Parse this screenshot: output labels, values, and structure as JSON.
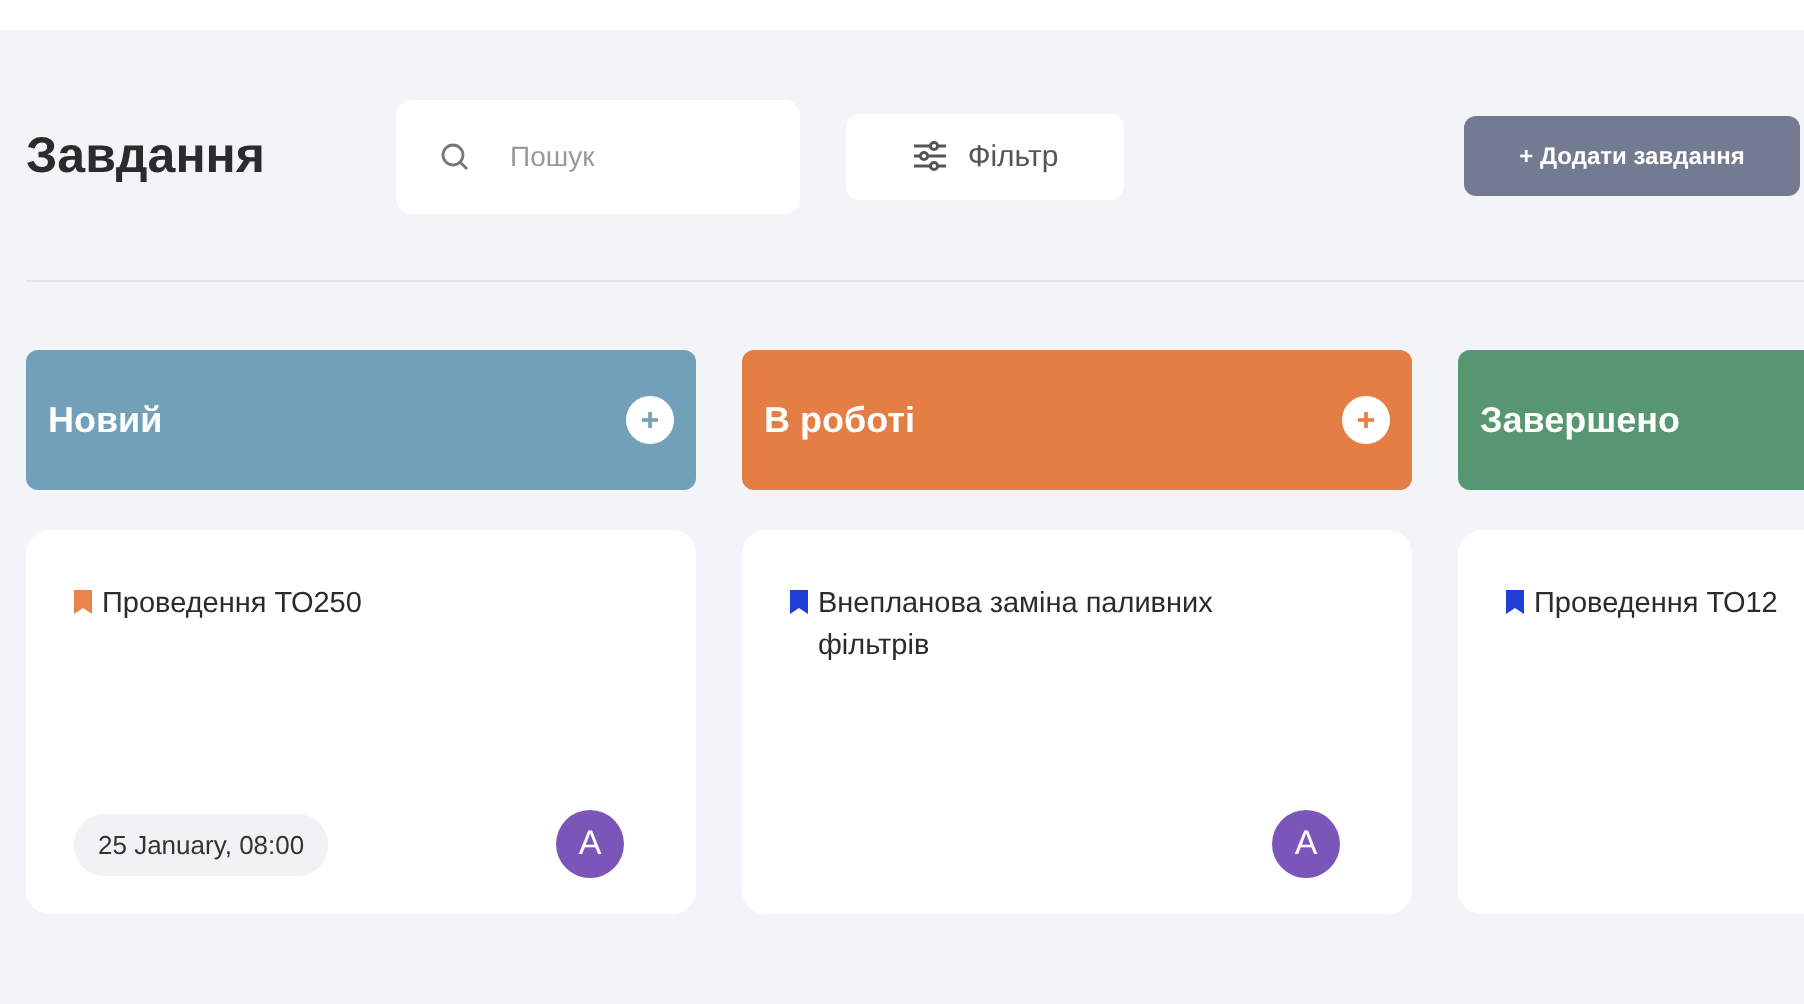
{
  "header": {
    "title": "Завдання",
    "search": {
      "placeholder": "Пошук"
    },
    "filter_button": "Фільтр",
    "add_button": "+ Додати завдання"
  },
  "columns": [
    {
      "title": "Новий",
      "color": "#72a0b9",
      "has_add": true,
      "cards": [
        {
          "title": "Проведення ТО250",
          "color": "#e8834a",
          "date": "25 January, 08:00",
          "avatar": "A"
        }
      ]
    },
    {
      "title": "В роботі",
      "color": "#e57e45",
      "has_add": true,
      "cards": [
        {
          "title": "Внепланова заміна паливних фільтрів",
          "color": "#1f3fd6",
          "avatar": "A"
        }
      ]
    },
    {
      "title": "Завершено",
      "color": "#569670",
      "has_add": false,
      "cards": [
        {
          "title": "Проведення ТО12",
          "color": "#1f3fd6"
        }
      ]
    }
  ]
}
